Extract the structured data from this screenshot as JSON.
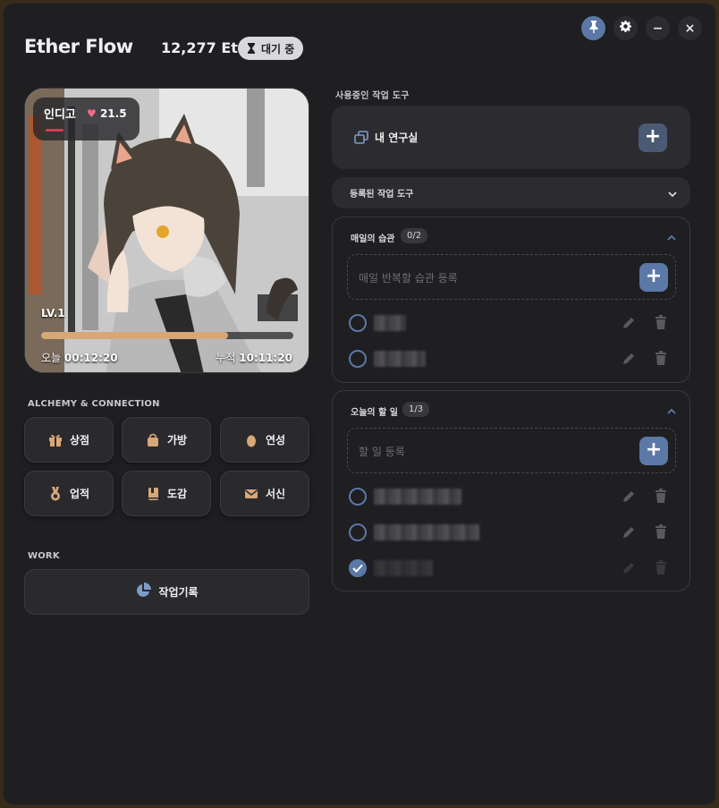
{
  "app": {
    "title": "Ether Flow",
    "balance": "12,277 Et",
    "status": "대기 중"
  },
  "window": {
    "pin": "pin-icon",
    "settings": "gear-icon",
    "minimize": "−",
    "close": "×"
  },
  "character": {
    "name": "인디고",
    "affection": "21.5",
    "level": "LV.1",
    "xp_fraction": 0.74,
    "today_label": "오늘",
    "today_time": "00:12:20",
    "total_label": "누적",
    "total_time": "10:11:20"
  },
  "alchemy": {
    "label": "ALCHEMY & CONNECTION",
    "buttons": [
      {
        "label": "상점",
        "icon": "gift-icon"
      },
      {
        "label": "가방",
        "icon": "bag-icon"
      },
      {
        "label": "연성",
        "icon": "egg-icon"
      },
      {
        "label": "업적",
        "icon": "medal-icon"
      },
      {
        "label": "도감",
        "icon": "book-icon"
      },
      {
        "label": "서신",
        "icon": "mail-icon"
      }
    ]
  },
  "work": {
    "label": "WORK",
    "record_button": "작업기록"
  },
  "tools": {
    "section_label": "사용중인 작업 도구",
    "current": "내 연구실",
    "registered_dropdown": "등록된 작업 도구"
  },
  "habits": {
    "title": "매일의 습관",
    "count": "0/2",
    "placeholder": "매일 반복할 습관 등록"
  },
  "todos": {
    "title": "오늘의 할 일",
    "count": "1/3",
    "placeholder": "할 일 등록"
  },
  "colors": {
    "accent": "#5b78a6",
    "xp": "#d6a877",
    "heart": "#f06b8b",
    "background": "#1f1f22"
  }
}
